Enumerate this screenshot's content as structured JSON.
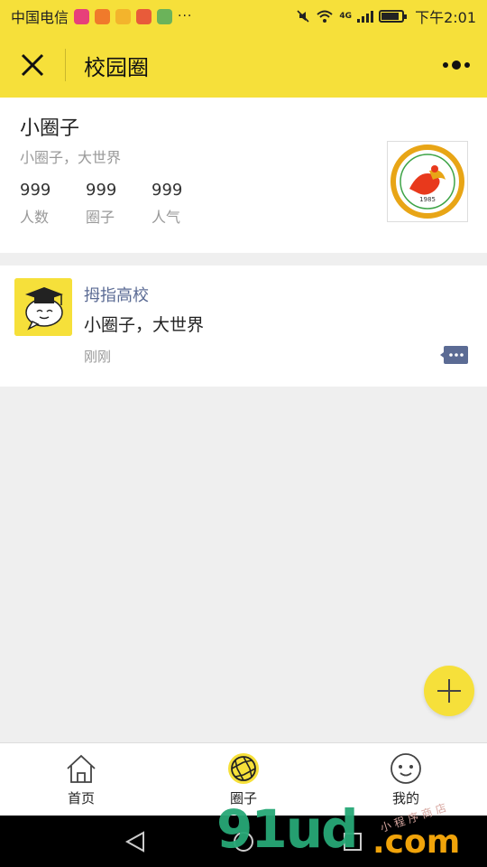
{
  "status_bar": {
    "carrier": "中国电信",
    "dots": "···",
    "network_type": "4G",
    "time": "下午2:01",
    "app_icons": [
      {
        "name": "heart-app-icon",
        "color": "#e7407a"
      },
      {
        "name": "browser-app-icon",
        "color": "#f07a2b"
      },
      {
        "name": "map-pin-app-icon",
        "color": "#f3b42c"
      },
      {
        "name": "home-app-icon",
        "color": "#e85b3a"
      },
      {
        "name": "book-app-icon",
        "color": "#6bb35a"
      }
    ]
  },
  "navbar": {
    "title": "校园圈",
    "close_icon": "close-icon",
    "more_icon": "more-icon"
  },
  "circle": {
    "name": "小圈子",
    "slogan": "小圈子，大世界",
    "stats": [
      {
        "value": "999",
        "label": "人数"
      },
      {
        "value": "999",
        "label": "圈子"
      },
      {
        "value": "999",
        "label": "人气"
      }
    ],
    "logo_year": "1985"
  },
  "post": {
    "author": "拇指高校",
    "content": "小圈子，大世界",
    "time": "刚刚"
  },
  "tabbar": {
    "items": [
      {
        "label": "首页",
        "icon": "home-icon",
        "active": false
      },
      {
        "label": "圈子",
        "icon": "aperture-icon",
        "active": true
      },
      {
        "label": "我的",
        "icon": "face-icon",
        "active": false
      }
    ]
  },
  "watermark": {
    "main": "91ud",
    "suffix": ".com",
    "cn": "小程序商店"
  },
  "colors": {
    "brand_yellow": "#f6e03a",
    "link_blue": "#5b6b94",
    "background": "#efefef"
  }
}
